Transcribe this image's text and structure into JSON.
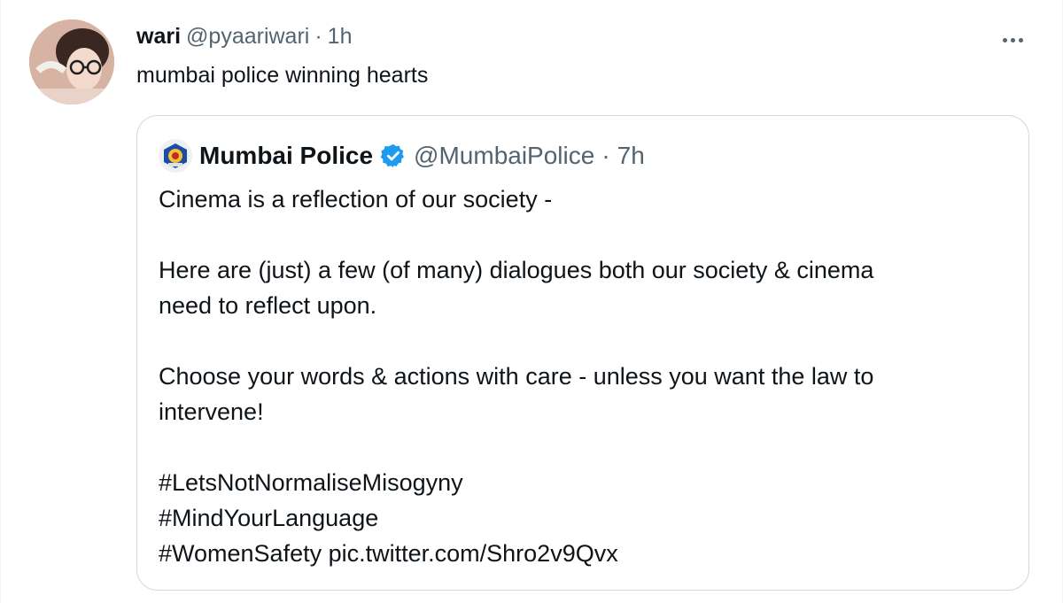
{
  "tweet": {
    "author_name": "wari",
    "handle": "@pyaariwari",
    "separator": "·",
    "time": "1h",
    "text": "mumbai police winning hearts",
    "more_icon": "more-horizontal-icon"
  },
  "quoted_tweet": {
    "author_name": "Mumbai Police",
    "handle": "@MumbaiPolice",
    "separator": "·",
    "time": "7h",
    "verified_icon": "verified-badge-icon",
    "lines": [
      "Cinema is a reflection of our society -",
      "Here are (just) a few (of many) dialogues both our society & cinema",
      "need to reflect upon.",
      "Choose your words & actions with care - unless you want the law to",
      "intervene!",
      "#LetsNotNormaliseMisogyny",
      "#MindYourLanguage",
      "#WomenSafety pic.twitter.com/Shro2v9Qvx"
    ]
  },
  "colors": {
    "text": "#0f1419",
    "muted": "#536471",
    "border": "#cfd9de",
    "verified": "#1d9bf0"
  }
}
